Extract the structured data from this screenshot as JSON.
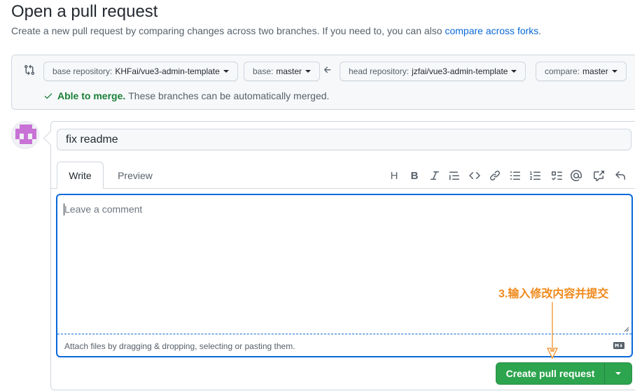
{
  "header": {
    "title": "Open a pull request",
    "subtitle_text": "Create a new pull request by comparing changes across two branches. If you need to, you can also ",
    "subtitle_link": "compare across forks",
    "subtitle_end": "."
  },
  "range": {
    "base_repo_label": "base repository:",
    "base_repo_value": "KHFai/vue3-admin-template",
    "base_label": "base:",
    "base_value": "master",
    "head_repo_label": "head repository:",
    "head_repo_value": "jzfai/vue3-admin-template",
    "compare_label": "compare:",
    "compare_value": "master",
    "merge_ok": "Able to merge.",
    "merge_msg": "These branches can be automatically merged."
  },
  "form": {
    "title_value": "fix readme",
    "tab_write": "Write",
    "tab_preview": "Preview",
    "toolbar": [
      "heading-icon",
      "bold-icon",
      "italic-icon",
      "quote-icon",
      "code-icon",
      "link-icon",
      "unordered-list-icon",
      "ordered-list-icon",
      "task-list-icon",
      "mention-icon",
      "cross-reference-icon",
      "reply-icon"
    ],
    "comment_placeholder": "Leave a comment",
    "attach_text": "Attach files by dragging & dropping, selecting or pasting them.",
    "create_label": "Create pull request"
  },
  "annotation": {
    "text": "3.输入修改内容并提交",
    "color": "#f08a1c"
  },
  "colors": {
    "accent": "#0969da",
    "success": "#2da44e",
    "success_text": "#1a7f37"
  }
}
